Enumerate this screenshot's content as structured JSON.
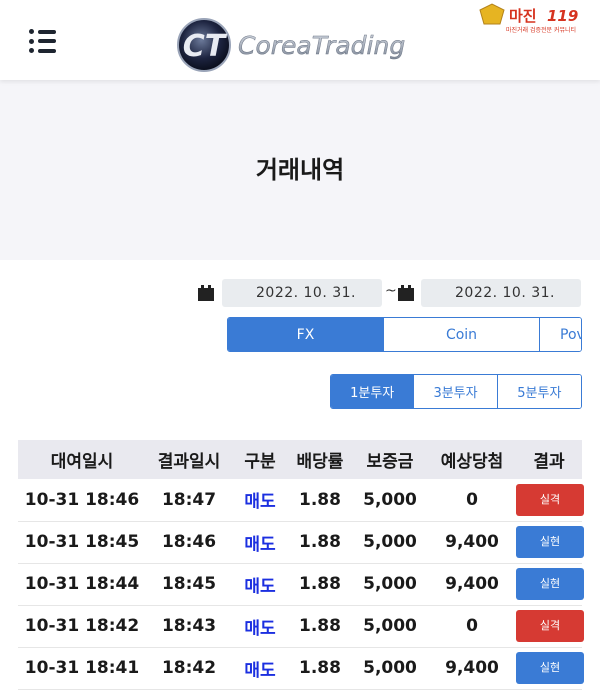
{
  "header": {
    "menu_icon": "hamburger-menu-icon",
    "logo_mark": "CT",
    "logo_text": "CoreaTrading"
  },
  "watermark": {
    "title": "마진",
    "number": "119",
    "subtitle": "마진거래 검증전문 커뮤니티"
  },
  "page": {
    "title": "거래내역"
  },
  "date_range": {
    "calendar_icon": "calendar-icon",
    "start": "2022. 10. 31.",
    "separator": "~",
    "end": "2022. 10. 31."
  },
  "market_tabs": [
    {
      "label": "FX",
      "active": true
    },
    {
      "label": "Coin",
      "active": false
    },
    {
      "label": "Pov",
      "active": false
    }
  ],
  "interval_tabs": [
    {
      "label": "1분투자",
      "active": true
    },
    {
      "label": "3분투자",
      "active": false
    },
    {
      "label": "5분투자",
      "active": false
    }
  ],
  "table": {
    "headers": [
      "대여일시",
      "결과일시",
      "구분",
      "배당률",
      "보증금",
      "예상당첨",
      "결과"
    ],
    "rows": [
      {
        "rent_time": "10-31 18:46",
        "result_time": "18:47",
        "side": "매도",
        "rate": "1.88",
        "deposit": "5,000",
        "expected": "0",
        "result": "실격",
        "result_color": "#d63a33"
      },
      {
        "rent_time": "10-31 18:45",
        "result_time": "18:46",
        "side": "매도",
        "rate": "1.88",
        "deposit": "5,000",
        "expected": "9,400",
        "result": "실현",
        "result_color": "#3a7bd5"
      },
      {
        "rent_time": "10-31 18:44",
        "result_time": "18:45",
        "side": "매도",
        "rate": "1.88",
        "deposit": "5,000",
        "expected": "9,400",
        "result": "실현",
        "result_color": "#3a7bd5"
      },
      {
        "rent_time": "10-31 18:42",
        "result_time": "18:43",
        "side": "매도",
        "rate": "1.88",
        "deposit": "5,000",
        "expected": "0",
        "result": "실격",
        "result_color": "#d63a33"
      },
      {
        "rent_time": "10-31 18:41",
        "result_time": "18:42",
        "side": "매도",
        "rate": "1.88",
        "deposit": "5,000",
        "expected": "9,400",
        "result": "실현",
        "result_color": "#3a7bd5"
      }
    ]
  },
  "colors": {
    "accent": "#3a7bd5",
    "loss": "#d63a33",
    "sell_text": "#1b2fe0",
    "hero_bg": "#f5f5f9"
  }
}
